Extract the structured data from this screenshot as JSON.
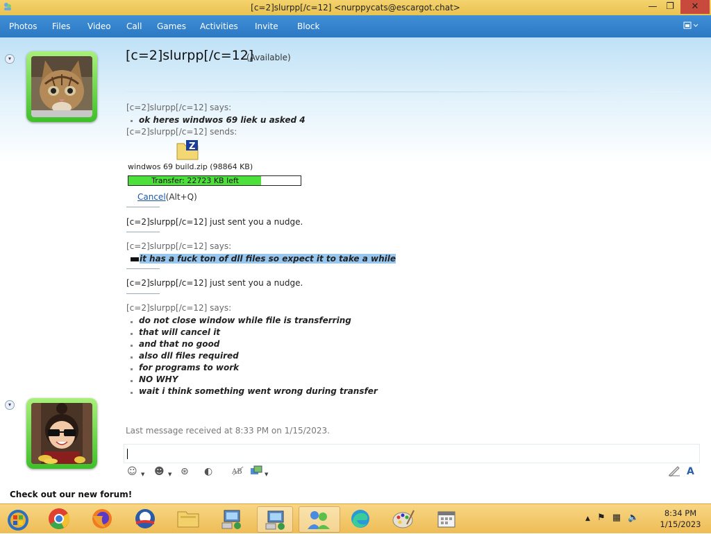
{
  "window": {
    "title": "[c=2]slurpp[/c=12] <nurppycats@escargot.chat>",
    "min_label": "—",
    "max_label": "❐",
    "close_label": "✕"
  },
  "menu": {
    "items": [
      "Photos",
      "Files",
      "Video",
      "Call",
      "Games",
      "Activities",
      "Invite",
      "Block"
    ]
  },
  "contact": {
    "name": "[c=2]slurpp[/c=12]",
    "status": "(Available)"
  },
  "conversation": {
    "says_1": "[c=2]slurpp[/c=12] says:",
    "msg_1": "ok heres windwos 69 liek u asked 4",
    "sends": "[c=2]slurpp[/c=12] sends:",
    "file_icon_letter": "Z",
    "file_name": "windwos 69 build.zip (98864 KB)",
    "transfer_label": "Transfer: 22723 KB left",
    "transfer_progress": 0.77,
    "cancel_link": "Cancel",
    "cancel_shortcut": "(Alt+Q)",
    "nudge_1": "[c=2]slurpp[/c=12] just sent you a nudge.",
    "says_2": "[c=2]slurpp[/c=12] says:",
    "msg_2": "it has a fuck ton of dll files so expect it to take a while",
    "nudge_2": "[c=2]slurpp[/c=12] just sent you a nudge.",
    "says_3": "[c=2]slurpp[/c=12] says:",
    "msgs_3": [
      "do not close window while file is transferring",
      "that will cancel it",
      "and that no good",
      "also dll files required",
      "for programs to work",
      "NO WHY",
      "wait i think something went wrong during transfer"
    ]
  },
  "footer": {
    "last_message": "Last message received at 8:33 PM on 1/15/2023.",
    "forum_text": "Check out our new forum!"
  },
  "taskbar": {
    "time": "8:34 PM",
    "date": "1/15/2023"
  },
  "colors": {
    "accent_blue": "#2c78c3",
    "progress_green": "#4de03a",
    "avatar_green": "#3fbf2a",
    "highlight": "#97c6ef"
  }
}
